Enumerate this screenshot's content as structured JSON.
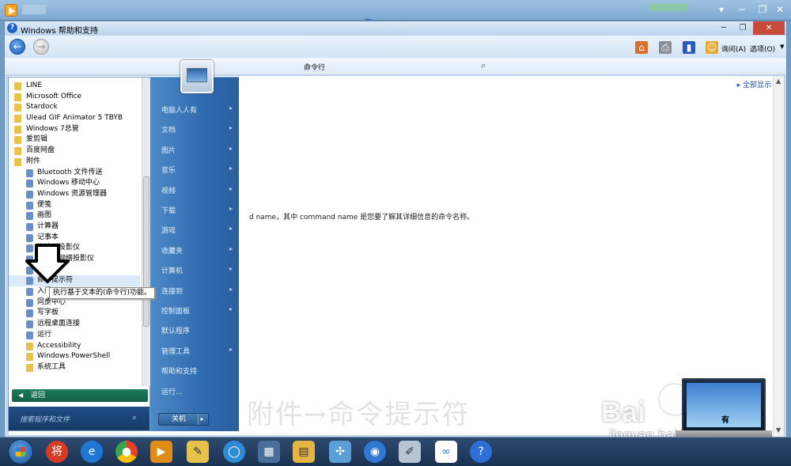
{
  "window": {
    "title": "Windows 帮助和支持",
    "ask_label": "询问(A)",
    "options_label": "选项(O)",
    "minimize_glyph": "─",
    "restore_glyph": "❐",
    "close_glyph": "✕"
  },
  "player": {
    "minimize_glyph": "▾",
    "restore_glyph": "─",
    "maximize_glyph": "❐",
    "close_glyph": "✕"
  },
  "search": {
    "query": "命令行",
    "icon": "magnifier-icon"
  },
  "content": {
    "show_all": "全部显示",
    "body_text": "d name，其中 command name 是您要了解其详细信息的命令名称。"
  },
  "menu": {
    "folders_top": [
      "LINE",
      "Microsoft Office",
      "Stardock",
      "Ulead GIF Animator 5 TBYB",
      "Windows 7总管",
      "爱剪辑",
      "百度网盘",
      "附件"
    ],
    "accessories": [
      "Bluetooth 文件传送",
      "Windows 移动中心",
      "Windows 资源管理器",
      "便笺",
      "画图",
      "计算器",
      "记事本",
      "连接到投影仪",
      "连接到网络投影仪",
      "录音机",
      "命令提示符",
      "入门",
      "同步中心",
      "写字板",
      "远程桌面连接",
      "运行"
    ],
    "folders_bottom": [
      "Accessibility",
      "Windows PowerShell",
      "系统工具"
    ],
    "highlighted_index": 10,
    "back_label": "返回",
    "search_placeholder": "搜索程序和文件"
  },
  "right_menu": {
    "items": [
      "电脑人人有",
      "文档",
      "图片",
      "音乐",
      "视频",
      "下载",
      "游戏",
      "收藏夹",
      "计算机",
      "连接到",
      "控制面板",
      "默认程序",
      "管理工具",
      "帮助和支持",
      "运行..."
    ],
    "has_submenu": [
      true,
      true,
      true,
      true,
      true,
      true,
      true,
      true,
      true,
      true,
      true,
      false,
      true,
      false,
      false
    ],
    "shutdown_label": "关机"
  },
  "tooltip": "执行基于文本的(命令行)功能。",
  "overlay_caption": "附件→命令提示符",
  "watermark": {
    "brand_left": "Bai",
    "brand_right": "经验",
    "url": "jingyan.baidu.com",
    "laptop_text": "有"
  },
  "taskbar": {
    "apps": [
      "start-orb",
      "jiang-app",
      "internet-explorer",
      "chrome",
      "media-player",
      "notes",
      "browser-ring",
      "remote-desktop",
      "file-explorer",
      "network",
      "ie-alt",
      "paint",
      "baidu-netdisk",
      "help"
    ],
    "jiang_glyph": "将",
    "help_glyph": "?"
  },
  "colors": {
    "start_panel": "#2e6aae",
    "back_bar": "#126145",
    "taskbar": "#1a3252",
    "link": "#1c4f9a"
  }
}
